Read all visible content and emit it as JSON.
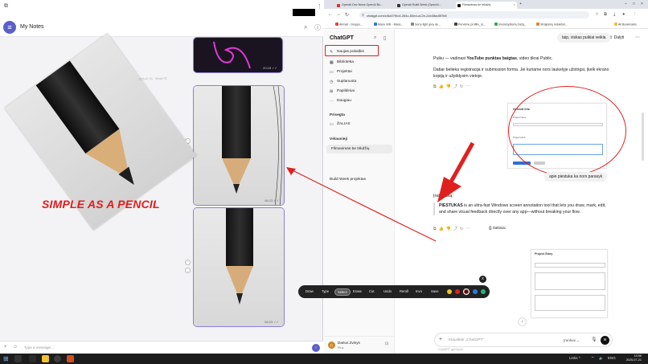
{
  "notes": {
    "title": "My Notes",
    "simple_text": "SIMPLE AS A PENCIL",
    "faint_caption": "2025-07-21 · Image 02",
    "image_times": [
      "20:15 ✓✓",
      "08:23 ✓✓",
      "08:23 ✓✓"
    ],
    "type_placeholder": "Type a message..."
  },
  "browser": {
    "tabs": [
      {
        "label": "OpenAI Dev News OpenAI Bu...",
        "color": "#d93025"
      },
      {
        "label": "OpenAI Build Week (OpenAI...",
        "color": "#333333"
      },
      {
        "label": "Filmavimas be trikdžių",
        "color": "#111111"
      }
    ],
    "url": "chatgpt.com/c/6a0?f0c4-264c-83ed-a12e-2cb38ad5f7b8",
    "bookmarks": [
      "Airmail - Gruppo...",
      "Mano VMI - Mano...",
      "Sorry light grey de...",
      "Pervėme profilio_ro...",
      "Įmonėsystemų bažą...",
      "Straipsnių redaktori...",
      "All Bookmarks"
    ]
  },
  "gpt_sidebar": {
    "logo": "ChatGPT",
    "items": [
      {
        "label": "Naujas pokalbis",
        "icon": "✎"
      },
      {
        "label": "Biblioteka",
        "icon": "▦"
      },
      {
        "label": "Projektai",
        "icon": "▭"
      },
      {
        "label": "Suplanuota",
        "icon": "◷"
      },
      {
        "label": "Papildiniai",
        "icon": "⊞"
      },
      {
        "label": "Daugiau",
        "icon": "⋯"
      }
    ],
    "section_pinned": "Prisegta",
    "pinned_item": "ŽALIAS",
    "section_own": "Vėlausieji",
    "own_item": "Filmavimas be trikdžių",
    "project_item": "Build Week projektas",
    "user_name": "Darius Zvinys",
    "user_plan": "Plus"
  },
  "gpt_main": {
    "share_label": "Dalyti",
    "user_bubble_1": "taip, viskas puikiai veikia",
    "msg_1_prefix": "Puiku — vadinasi ",
    "msg_1_bold": "YouTube punktas baigtas",
    "msg_1_suffix": ", video tikrai Public.",
    "msg_2": "Dabar belieka registracija ir submission forma. Jei kuriame nors laukelyje užstrigsi, įkelk ekrano kopiją ir užpildysim vietoje.",
    "form_title": "General Info",
    "form_label_1": "Project name",
    "form_label_2": "Project pitch",
    "user_bubble_2": "apie piestuka ka nors parasyk",
    "msg_3_label": "Įrašyk šitą:",
    "quote_bold": "PIESTUKAS",
    "quote_text": " is an ultra-fast Windows screen annotation tool that lets you draw, mark, edit, and share visual feedback directly over any app—without breaking your flow.",
    "share_action": "Šaltiniai",
    "form2_title": "Project Story",
    "composer_placeholder": "Klauskite „ChatGPT“",
    "composer_tools": "Įrankiai",
    "disclaimer": "ChatGPT gali klysti."
  },
  "annot_toolbar": {
    "buttons": [
      "Draw",
      "Type",
      "Select",
      "Erase",
      "Cut",
      "Undo",
      "Reroll",
      "Invo",
      "Save"
    ],
    "active": "Select",
    "colors": [
      "#f4c21a",
      "#e0201f",
      "#222222",
      "#2a7be4",
      "#22b573",
      "#ff5fa8"
    ],
    "selected_color": "#222222",
    "close_label": "x"
  },
  "taskbar": {
    "tray": "Links  ^",
    "lang": "ENG",
    "time": "15:56",
    "date": "2025-07-21"
  }
}
